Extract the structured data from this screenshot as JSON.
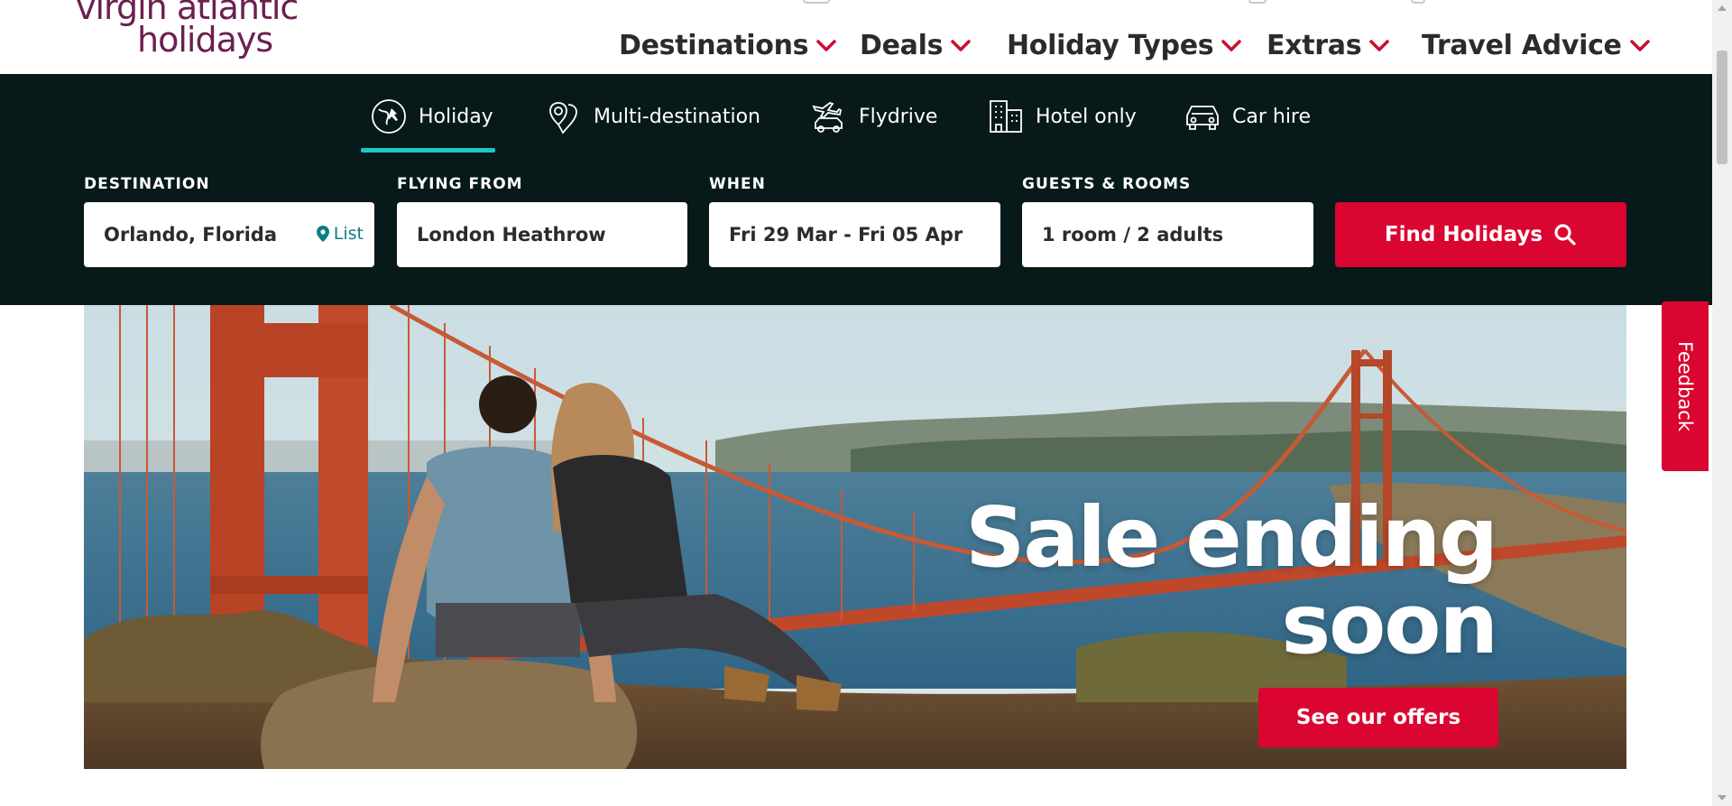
{
  "brand": {
    "logo_line1": "virgin atlantic",
    "logo_line2": "holidays",
    "color": "#6b1f4f"
  },
  "nav": {
    "items": [
      {
        "label": "Destinations"
      },
      {
        "label": "Deals"
      },
      {
        "label": "Holiday Types"
      },
      {
        "label": "Extras"
      },
      {
        "label": "Travel Advice"
      }
    ]
  },
  "search": {
    "tabs": [
      {
        "label": "Holiday",
        "icon": "globe-plane-icon",
        "active": true
      },
      {
        "label": "Multi-destination",
        "icon": "map-pins-icon",
        "active": false
      },
      {
        "label": "Flydrive",
        "icon": "plane-car-icon",
        "active": false
      },
      {
        "label": "Hotel only",
        "icon": "building-icon",
        "active": false
      },
      {
        "label": "Car hire",
        "icon": "car-icon",
        "active": false
      }
    ],
    "destination": {
      "label": "DESTINATION",
      "value": "Orlando, Florida",
      "list_link": "List"
    },
    "flying_from": {
      "label": "FLYING FROM",
      "value": "London Heathrow"
    },
    "when": {
      "label": "WHEN",
      "value": "Fri 29 Mar - Fri 05 Apr"
    },
    "guests": {
      "label": "GUESTS & ROOMS",
      "value": "1 room / 2 adults"
    },
    "submit_label": "Find Holidays"
  },
  "hero": {
    "title_line1": "Sale ending",
    "title_line2": "soon",
    "cta_label": "See our offers"
  },
  "feedback_label": "Feedback",
  "colors": {
    "band": "#071a19",
    "accent_red": "#da0530",
    "tab_underline": "#21c6c6",
    "nav_chevron": "#c8102e"
  }
}
